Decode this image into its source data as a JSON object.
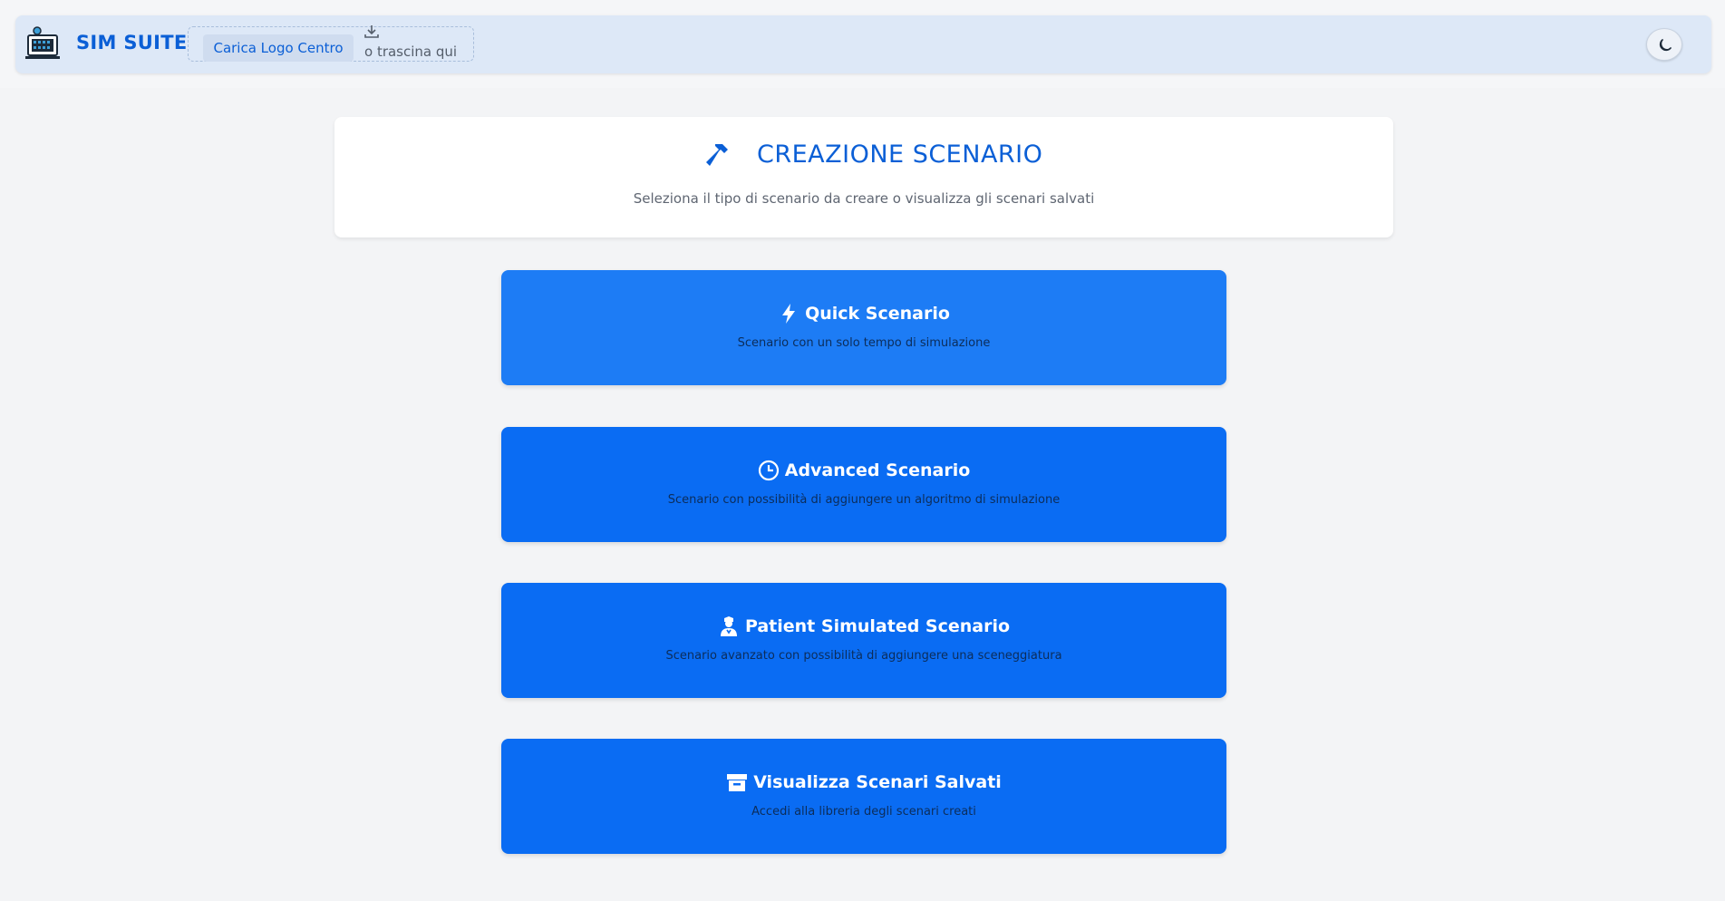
{
  "app": {
    "brand": "SIM SUITE",
    "upload_label": "Carica Logo Centro",
    "drag_text": "o trascina qui",
    "theme_icon": "moon-icon"
  },
  "header": {
    "title": "CREAZIONE SCENARIO",
    "subtitle": "Seleziona il tipo di scenario da creare o visualizza gli scenari salvati",
    "icon": "hammer-icon"
  },
  "options": [
    {
      "title": "Quick Scenario",
      "subtitle": "Scenario con un solo tempo di simulazione",
      "icon": "bolt-icon"
    },
    {
      "title": "Advanced Scenario",
      "subtitle": "Scenario con possibilità di aggiungere un algoritmo di simulazione",
      "icon": "clock-icon"
    },
    {
      "title": "Patient Simulated Scenario",
      "subtitle": "Scenario avanzato con possibilità di aggiungere una sceneggiatura",
      "icon": "user-nurse-icon"
    },
    {
      "title": "Visualizza Scenari Salvati",
      "subtitle": "Accedi alla libreria degli scenari creati",
      "icon": "archive-icon"
    }
  ],
  "colors": {
    "accent": "#0b5fd6",
    "card_primary": "#0a6cf3",
    "card_hover": "#1d7cf5",
    "topbar": "#dde8f7"
  }
}
